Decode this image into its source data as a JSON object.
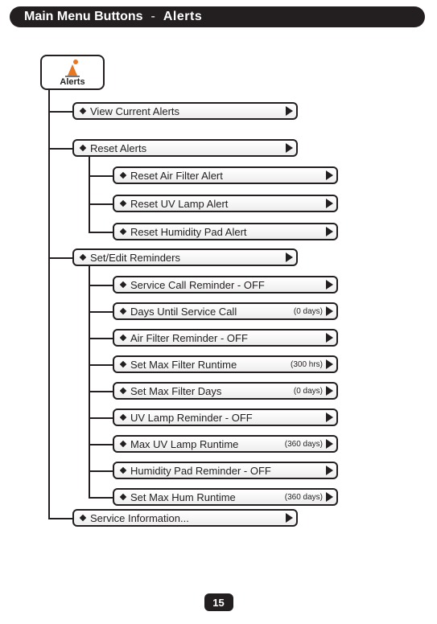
{
  "header": {
    "main": "Main Menu Buttons",
    "separator": "-",
    "sub": "Alerts"
  },
  "root": {
    "label": "Alerts"
  },
  "level1": {
    "view_current": "View Current Alerts",
    "reset": "Reset Alerts",
    "set_edit": "Set/Edit Reminders",
    "service_info": "Service Information..."
  },
  "reset_children": {
    "air_filter": "Reset Air Filter Alert",
    "uv_lamp": "Reset UV Lamp Alert",
    "humidity": "Reset Humidity Pad Alert"
  },
  "reminder_children": {
    "service_call": {
      "label": "Service Call Reminder - OFF",
      "value": ""
    },
    "days_until": {
      "label": "Days Until Service Call",
      "value": "(0 days)"
    },
    "air_filter": {
      "label": "Air Filter Reminder - OFF",
      "value": ""
    },
    "max_filter_rt": {
      "label": "Set Max Filter Runtime",
      "value": "(300 hrs)"
    },
    "max_filter_d": {
      "label": "Set Max Filter Days",
      "value": "(0 days)"
    },
    "uv_lamp": {
      "label": "UV Lamp Reminder - OFF",
      "value": ""
    },
    "max_uv": {
      "label": "Max UV Lamp Runtime",
      "value": "(360 days)"
    },
    "hum_pad": {
      "label": "Humidity Pad Reminder - OFF",
      "value": ""
    },
    "max_hum": {
      "label": "Set Max Hum Runtime",
      "value": "(360 days)"
    }
  },
  "page_number": "15"
}
